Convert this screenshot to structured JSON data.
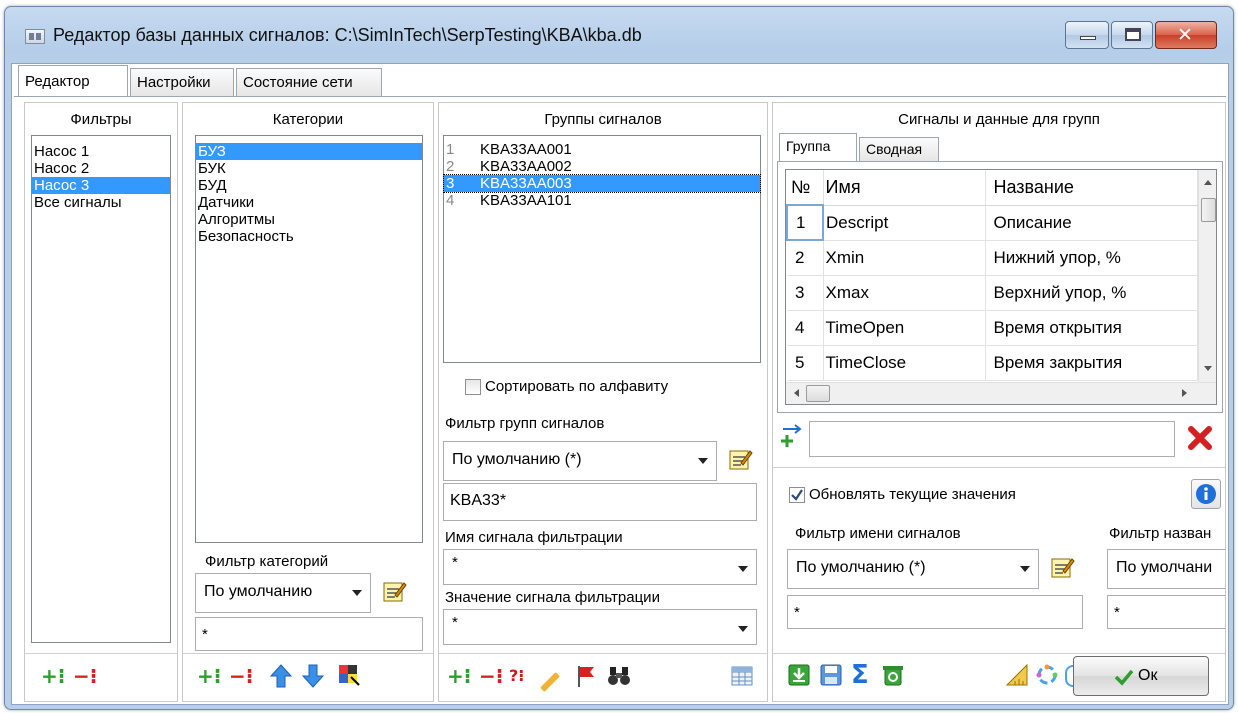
{
  "window": {
    "title": "Редактор базы данных сигналов: C:\\SimInTech\\SerpTesting\\KBA\\kba.db"
  },
  "tabs": [
    "Редактор",
    "Настройки",
    "Состояние сети"
  ],
  "filters": {
    "title": "Фильтры",
    "items": [
      "Насос 1",
      "Насос 2",
      "Насос 3",
      "Все сигналы"
    ],
    "selected": "Насос 3"
  },
  "categories": {
    "title": "Категории",
    "items": [
      "БУЗ",
      "БУК",
      "БУД",
      "Датчики",
      "Алгоритмы",
      "Безопасность"
    ],
    "selected": "БУЗ",
    "filter_label": "Фильтр категорий",
    "filter_value": "По умолчанию",
    "filter_text": "*"
  },
  "groups": {
    "title": "Группы сигналов",
    "items": [
      {
        "num": "1",
        "name": "KBA33AA001"
      },
      {
        "num": "2",
        "name": "KBA33AA002"
      },
      {
        "num": "3",
        "name": "KBA33AA003"
      },
      {
        "num": "4",
        "name": "KBA33AA101"
      }
    ],
    "selected": "KBA33AA003",
    "sort_label": "Сортировать по алфавиту",
    "sort_checked": false,
    "filter_label": "Фильтр групп сигналов",
    "filter_value": "По умолчанию (*)",
    "filter_text": "KBA33*",
    "signal_name_label": "Имя сигнала фильтрации",
    "signal_name_value": "*",
    "signal_value_label": "Значение сигнала фильтрации",
    "signal_value_value": "*"
  },
  "signals": {
    "title": "Сигналы и данные для групп",
    "subtabs": [
      "Группа",
      "Сводная"
    ],
    "columns": [
      "№",
      "Имя",
      "Название"
    ],
    "rows": [
      {
        "num": "1",
        "name": "Descript",
        "title": "Описание"
      },
      {
        "num": "2",
        "name": "Xmin",
        "title": "Нижний упор, %"
      },
      {
        "num": "3",
        "name": "Xmax",
        "title": "Верхний упор, %"
      },
      {
        "num": "4",
        "name": "TimeOpen",
        "title": "Время открытия"
      },
      {
        "num": "5",
        "name": "TimeClose",
        "title": "Время закрытия"
      }
    ],
    "update_label": "Обновлять текущие значения",
    "update_checked": true,
    "name_filter_label": "Фильтр имени сигналов",
    "name_filter_value": "По умолчанию (*)",
    "name_filter_text": "*",
    "title_filter_label": "Фильтр назван",
    "title_filter_value": "По умолчани",
    "title_filter_text": "*"
  },
  "ok_button": {
    "label": "Ок"
  },
  "colors": {
    "selection": "#3399ff",
    "accent_green": "#2e9e2e",
    "accent_red": "#d42020",
    "accent_blue": "#1e6fd9"
  }
}
